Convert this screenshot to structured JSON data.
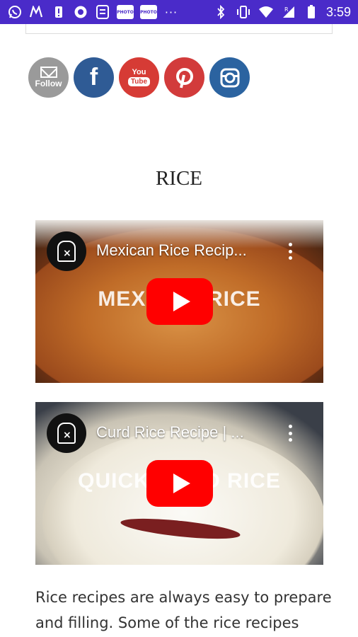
{
  "status_bar": {
    "time": "3:59",
    "left_icons": [
      "whatsapp-icon",
      "my-app-icon",
      "alert-icon",
      "record-icon",
      "file-icon",
      "photo-icon",
      "photo-icon",
      "more-icon"
    ],
    "photo_label": "PHOTO",
    "right_icons": [
      "bluetooth-icon",
      "vibrate-icon",
      "wifi-icon",
      "signal-icon",
      "battery-icon"
    ]
  },
  "social": {
    "follow_label": "Follow",
    "facebook_glyph": "f",
    "youtube_you": "You",
    "youtube_tube": "Tube"
  },
  "section": {
    "heading": "RICE"
  },
  "videos": [
    {
      "title": "Mexican Rice Recip...",
      "overlay": "MEXICAN RICE"
    },
    {
      "title": "Curd Rice Recipe | ...",
      "overlay": "QUICK CURD RICE"
    }
  ],
  "body": {
    "text": "Rice recipes are always easy to prepare and filling. Some of the rice recipes"
  },
  "colors": {
    "status_bar": "#4a2bc9",
    "follow": "#9a9a9a",
    "facebook": "#2f5b95",
    "youtube": "#d63b35",
    "pinterest": "#d23b3b",
    "instagram": "#2b63a0",
    "play_button": "#ff0000"
  }
}
